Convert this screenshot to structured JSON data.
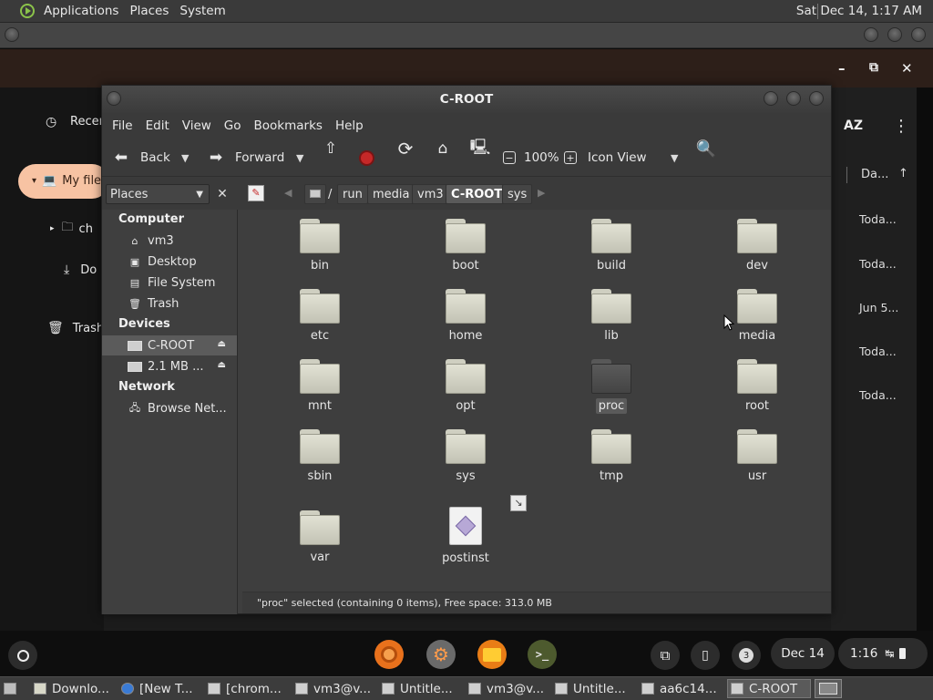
{
  "top_panel": {
    "menus": [
      "Applications",
      "Places",
      "System"
    ],
    "clock": "Sat Dec 14,  1:17 AM"
  },
  "cros_window": {
    "controls": [
      "–",
      "⧉",
      "✕"
    ],
    "sidebar": {
      "recent": "Recen",
      "my_files": "My file",
      "child_folder": "ch",
      "downloads": "Do",
      "trash": "Trash"
    },
    "right": {
      "sort_label": "AZ",
      "date_header": "Da...",
      "dates": [
        "Toda...",
        "Toda...",
        "Jun 5...",
        "Toda...",
        "Toda..."
      ]
    }
  },
  "caja": {
    "title": "C-ROOT",
    "menu": [
      "File",
      "Edit",
      "View",
      "Go",
      "Bookmarks",
      "Help"
    ],
    "toolbar": {
      "back": "Back",
      "forward": "Forward",
      "zoom": "100%",
      "view_mode": "Icon View"
    },
    "places_combo": "Places",
    "breadcrumbs": [
      "/",
      "run",
      "media",
      "vm3",
      "C-ROOT",
      "sys"
    ],
    "active_crumb": "C-ROOT",
    "sidebar": {
      "computer_heading": "Computer",
      "computer_items": [
        "vm3",
        "Desktop",
        "File System",
        "Trash"
      ],
      "devices_heading": "Devices",
      "devices_items": [
        "C-ROOT",
        "2.1 MB ..."
      ],
      "network_heading": "Network",
      "network_items": [
        "Browse Net..."
      ]
    },
    "items": [
      "bin",
      "boot",
      "build",
      "dev",
      "etc",
      "home",
      "lib",
      "media",
      "mnt",
      "opt",
      "proc",
      "root",
      "sbin",
      "sys",
      "tmp",
      "usr",
      "var",
      "postinst"
    ],
    "selected_item": "proc",
    "status": "\"proc\" selected (containing 0 items), Free space: 313.0 MB"
  },
  "shelf": {
    "notification_count": "3",
    "date": "Dec 14",
    "time": "1:16"
  },
  "taskbar": {
    "tasks": [
      "Downlo...",
      "[New T...",
      "[chrom...",
      "vm3@v...",
      "Untitle...",
      "vm3@v...",
      "Untitle...",
      "aa6c14...",
      "C-ROOT"
    ]
  }
}
